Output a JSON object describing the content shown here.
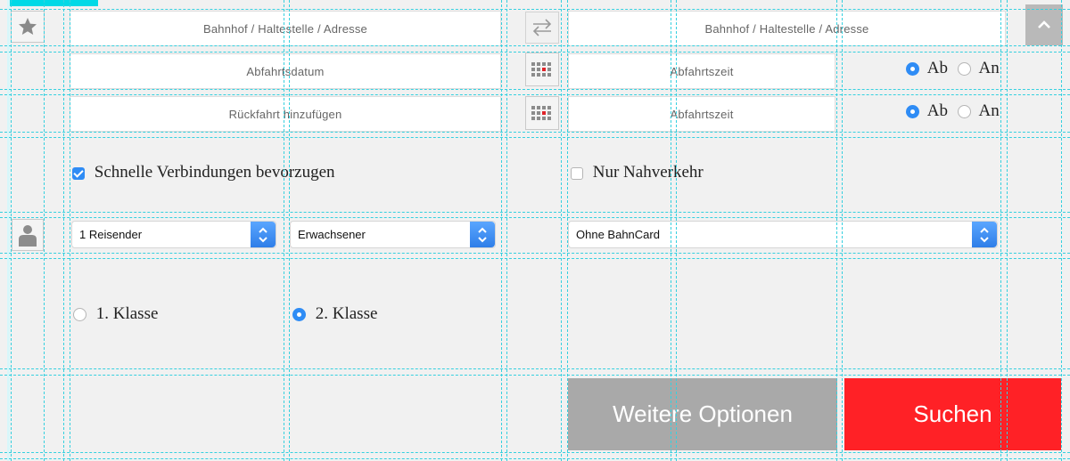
{
  "from": {
    "placeholder": "Bahnhof / Haltestelle / Adresse"
  },
  "to": {
    "placeholder": "Bahnhof / Haltestelle / Adresse"
  },
  "outbound": {
    "date_placeholder": "Abfahrtsdatum",
    "time_placeholder": "Abfahrtszeit",
    "ab_label": "Ab",
    "an_label": "An",
    "selected": "Ab"
  },
  "return": {
    "date_placeholder": "Rückfahrt hinzufügen",
    "time_placeholder": "Abfahrtszeit",
    "ab_label": "Ab",
    "an_label": "An",
    "selected": "Ab"
  },
  "options": {
    "fast_connections_label": "Schnelle Verbindungen bevorzugen",
    "fast_connections_checked": true,
    "local_only_label": "Nur Nahverkehr",
    "local_only_checked": false
  },
  "travellers": {
    "count": "1 Reisender",
    "type": "Erwachsener",
    "bahncard": "Ohne BahnCard"
  },
  "class": {
    "first_label": "1. Klasse",
    "second_label": "2. Klasse",
    "selected": "2. Klasse"
  },
  "buttons": {
    "more_options": "Weitere Optionen",
    "search": "Suchen"
  },
  "colors": {
    "accent_blue": "#2f8cf5",
    "search_red": "#ff2126",
    "options_gray": "#a9a9a9",
    "guide_cyan": "#35d0df"
  },
  "icons": {
    "favorite": "star-icon",
    "swap": "swap-arrows-icon",
    "calendar": "calendar-icon",
    "traveller": "person-icon",
    "collapse": "chevron-up-icon"
  }
}
